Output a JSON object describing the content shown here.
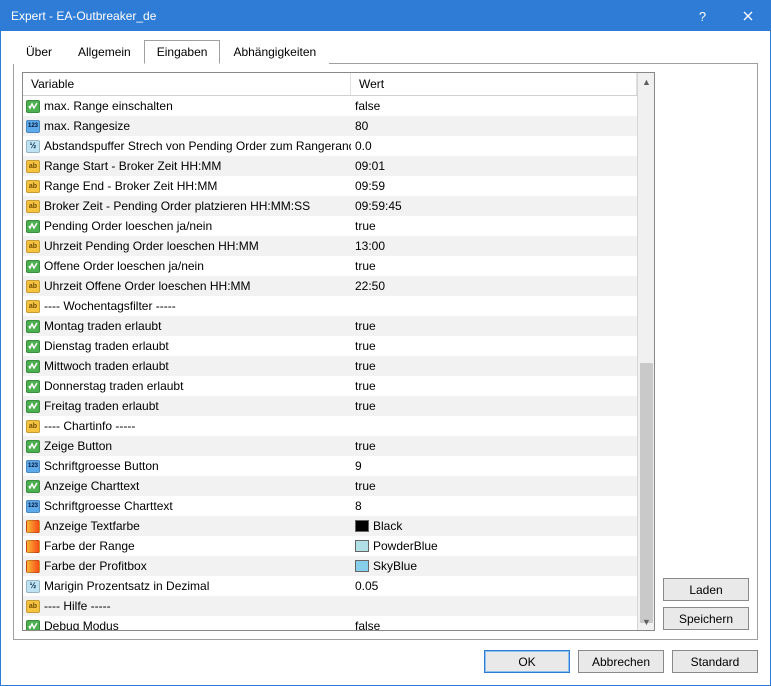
{
  "window": {
    "title": "Expert - EA-Outbreaker_de"
  },
  "tabs": [
    "Über",
    "Allgemein",
    "Eingaben",
    "Abhängigkeiten"
  ],
  "active_tab": 2,
  "columns": {
    "variable": "Variable",
    "value": "Wert"
  },
  "side_buttons": {
    "load": "Laden",
    "save": "Speichern"
  },
  "footer_buttons": {
    "ok": "OK",
    "cancel": "Abbrechen",
    "reset": "Standard"
  },
  "colors": {
    "Black": "#000000",
    "PowderBlue": "#B0E0E6",
    "SkyBlue": "#87CEEB"
  },
  "rows": [
    {
      "type": "bool",
      "name": "max. Range einschalten",
      "value": "false"
    },
    {
      "type": "int",
      "name": "max. Rangesize",
      "value": "80"
    },
    {
      "type": "dbl",
      "name": "Abstandspuffer Strech von Pending Order zum Rangerand",
      "value": "0.0"
    },
    {
      "type": "str",
      "name": "Range Start - Broker Zeit HH:MM",
      "value": "09:01"
    },
    {
      "type": "str",
      "name": "Range End - Broker Zeit HH:MM",
      "value": "09:59"
    },
    {
      "type": "str",
      "name": "Broker Zeit - Pending Order platzieren HH:MM:SS",
      "value": "09:59:45"
    },
    {
      "type": "bool",
      "name": "Pending Order loeschen ja/nein",
      "value": "true"
    },
    {
      "type": "str",
      "name": "Uhrzeit Pending Order loeschen HH:MM",
      "value": "13:00"
    },
    {
      "type": "bool",
      "name": "Offene Order loeschen ja/nein",
      "value": "true"
    },
    {
      "type": "str",
      "name": "Uhrzeit Offene Order loeschen HH:MM",
      "value": "22:50"
    },
    {
      "type": "str",
      "name": "---- Wochentagsfilter -----",
      "value": ""
    },
    {
      "type": "bool",
      "name": "Montag traden erlaubt",
      "value": "true"
    },
    {
      "type": "bool",
      "name": "Dienstag traden erlaubt",
      "value": "true"
    },
    {
      "type": "bool",
      "name": "Mittwoch traden erlaubt",
      "value": "true"
    },
    {
      "type": "bool",
      "name": "Donnerstag traden erlaubt",
      "value": "true"
    },
    {
      "type": "bool",
      "name": "Freitag traden erlaubt",
      "value": "true"
    },
    {
      "type": "str",
      "name": "---- Chartinfo -----",
      "value": ""
    },
    {
      "type": "bool",
      "name": "Zeige Button",
      "value": "true"
    },
    {
      "type": "int",
      "name": "Schriftgroesse Button",
      "value": "9"
    },
    {
      "type": "bool",
      "name": "Anzeige Charttext",
      "value": "true"
    },
    {
      "type": "int",
      "name": "Schriftgroesse Charttext",
      "value": "8"
    },
    {
      "type": "color",
      "name": "Anzeige Textfarbe",
      "value": "Black"
    },
    {
      "type": "color",
      "name": "Farbe der Range",
      "value": "PowderBlue"
    },
    {
      "type": "color",
      "name": "Farbe der Profitbox",
      "value": "SkyBlue"
    },
    {
      "type": "dbl",
      "name": "Marigin Prozentsatz in Dezimal",
      "value": "0.05"
    },
    {
      "type": "str",
      "name": "---- Hilfe -----",
      "value": ""
    },
    {
      "type": "bool",
      "name": "Debug Modus",
      "value": "false"
    }
  ]
}
